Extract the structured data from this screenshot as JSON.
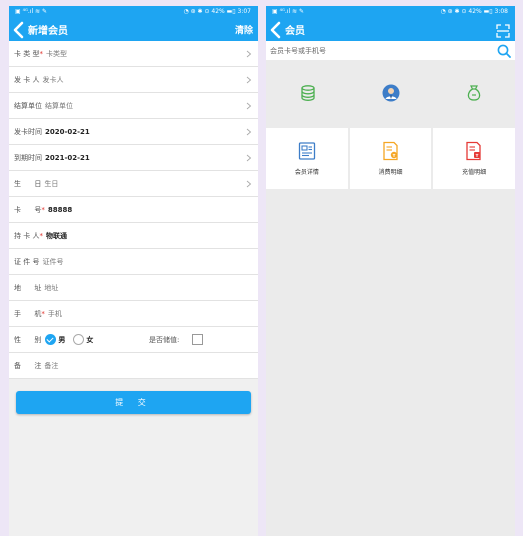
{
  "left": {
    "status": {
      "left": "▣ ⁴ᴳ.ıl ≋ ✎",
      "right": "◔ ⊛ ✱ ⊙ 42% ▬▯ 3:07"
    },
    "title": "新增会员",
    "clear": "清除",
    "rows": [
      {
        "label": "卡 类 型",
        "req": "*",
        "value": "卡类型"
      },
      {
        "label": "发 卡 人",
        "value": "发卡人"
      },
      {
        "label": "结算单位",
        "value": "结算单位"
      },
      {
        "label": "发卡时间",
        "value": "2020-02-21"
      },
      {
        "label": "到期时间",
        "value": "2021-02-21"
      },
      {
        "label": "生      日",
        "value": "生日"
      },
      {
        "label": "卡      号",
        "req": "*",
        "value": "88888"
      },
      {
        "label": "持 卡 人",
        "req": "*",
        "value": "物联通"
      },
      {
        "label": "证 件 号",
        "value": "证件号"
      },
      {
        "label": "地      址",
        "value": "地址"
      },
      {
        "label": "手      机",
        "req": "*",
        "value": "手机"
      },
      {
        "label": "性      别",
        "male": "男",
        "female": "女",
        "stored": "是否储值:"
      },
      {
        "label": "备      注",
        "value": "备注"
      }
    ],
    "submit": "提 交"
  },
  "right": {
    "status": {
      "left": "▣ ⁴ᴳ.ıl ≋ ✎",
      "right": "◔ ⊛ ✱ ⊙ 42% ▬▯ 3:08"
    },
    "title": "会员",
    "search_placeholder": "会员卡号或手机号",
    "tiles": [
      {
        "label": "会员详情",
        "icon": "member-card-icon"
      },
      {
        "label": "消费明细",
        "icon": "consumption-icon"
      },
      {
        "label": "充值明细",
        "icon": "recharge-icon"
      }
    ],
    "top_icons": [
      "coins-icon",
      "user-avatar-icon",
      "money-bag-icon"
    ]
  },
  "colors": {
    "primary": "#1ea5f2",
    "required": "#e0302a"
  }
}
